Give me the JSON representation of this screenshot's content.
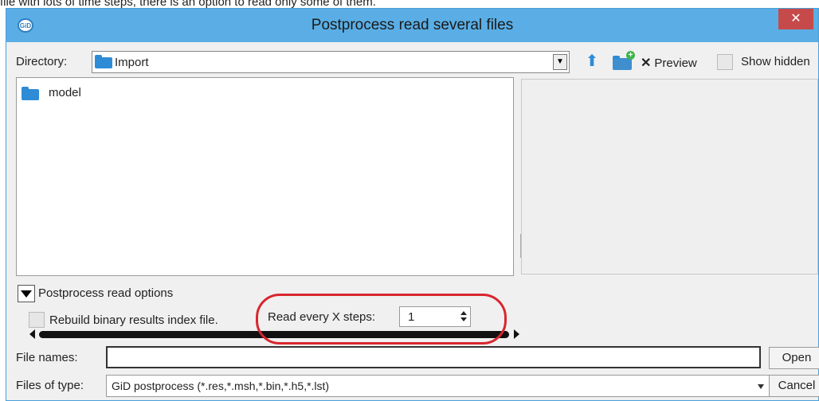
{
  "caption": "file with lots of time steps, there is an option to read only some of them.",
  "window": {
    "title": "Postprocess read several files",
    "close_glyph": "✕",
    "app_icon_text": "GiD"
  },
  "directory": {
    "label": "Directory:",
    "value": "Import",
    "preview_label": "Preview",
    "preview_checked": true,
    "show_hidden_label": "Show hidden",
    "show_hidden_checked": false
  },
  "file_list": {
    "items": [
      {
        "name": "model",
        "icon": "folder-icon"
      }
    ]
  },
  "options": {
    "toggle_label": "Postprocess read options",
    "rebuild_label": "Rebuild binary results index file.",
    "rebuild_checked": false,
    "steps_label": "Read every X steps:",
    "steps_value": "1"
  },
  "file_names": {
    "label": "File names:",
    "value": "",
    "open_label": "Open"
  },
  "file_types": {
    "label": "Files of type:",
    "value": "GiD postprocess (*.res,*.msh,*.bin,*.h5,*.lst)",
    "cancel_label": "Cancel"
  },
  "colors": {
    "titlebar": "#5aaee5",
    "highlight": "#d8262e",
    "folder": "#2e8bd6"
  }
}
